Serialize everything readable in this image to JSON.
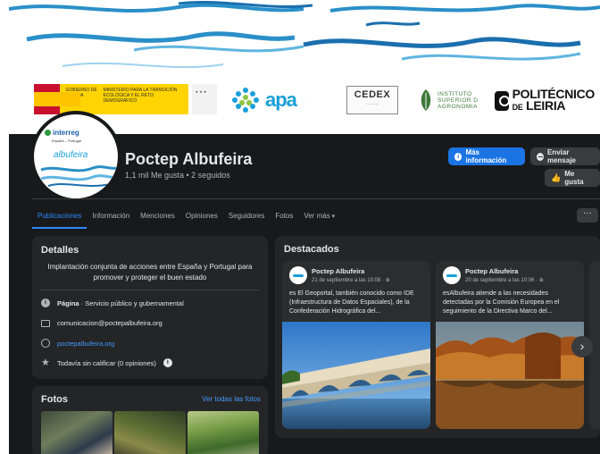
{
  "cover": {
    "partner_logos": {
      "gobierno": {
        "line1": "GOBIERNO DE ESPAÑA",
        "line2": "MINISTERIO PARA LA TRANSICIÓN ECOLÓGICA Y EL RETO DEMOGRÁFICO"
      },
      "apa": {
        "word": "apa"
      },
      "cedex": {
        "word": "CEDEX"
      },
      "isa": {
        "line1": "INSTITUTO",
        "line2": "SUPERIOR D",
        "line3": "AGRONOMIA"
      },
      "ipl": {
        "line1": "POLITÉCNICO",
        "line2_small": "DE",
        "line2": "LEIRIA"
      }
    }
  },
  "profile": {
    "logo_text": "interreg",
    "logo_name": "albufeira",
    "name": "Poctep Albufeira",
    "stats": "1,1 mil Me gusta • 2 seguidos"
  },
  "actions": {
    "more_info": "Más información",
    "send_message": "Enviar mensaje",
    "like": "Me gusta"
  },
  "tabs": [
    {
      "label": "Publicaciones",
      "active": true
    },
    {
      "label": "Información"
    },
    {
      "label": "Menciones"
    },
    {
      "label": "Opiniones"
    },
    {
      "label": "Seguidores"
    },
    {
      "label": "Fotos"
    },
    {
      "label": "Ver más"
    }
  ],
  "more_menu": "···",
  "details": {
    "title": "Detalles",
    "intro": "Implantación conjunta de acciones entre España y Portugal para promover y proteger el buen estado",
    "category_label": "Página",
    "category_value": " · Servicio público y gubernamental",
    "email": "comunicacion@poctepalbufeira.org",
    "website": "poctepalbufeira.org",
    "rating": "Todavía sin calificar (0 opiniones)"
  },
  "photos": {
    "title": "Fotos",
    "see_all": "Ver todas las fotos"
  },
  "featured": {
    "title": "Destacados",
    "posts": [
      {
        "author": "Poctep Albufeira",
        "date": "21 de septiembre a las 10:08 · ⊕",
        "text": "es El Geoportal, también conocido como IDE (Infraestructura de Datos Espaciales), de la Confederación Hidrográfica del..."
      },
      {
        "author": "Poctep Albufeira",
        "date": "20 de septiembre a las 10:06 · ⊕",
        "text": "esAlbufeira atiende a las necesidades detectadas por la Comisión Europea en el seguimiento de la Directiva Marco del..."
      }
    ],
    "next_arrow": "›"
  },
  "colors": {
    "background": "#18191a",
    "card": "#242526",
    "accent": "#1b74e4",
    "link": "#4599ff",
    "wave": "#2a8fc8"
  }
}
